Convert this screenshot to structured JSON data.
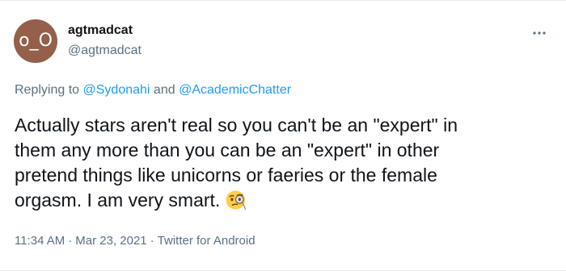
{
  "user": {
    "avatar_text": "o_O",
    "avatar_color": "#955f49",
    "display_name": "agtmadcat",
    "handle": "@agtmadcat"
  },
  "more_icon": "more-horizontal-icon",
  "reply": {
    "prefix": "Replying to",
    "mention1": "@Sydonahi",
    "conj": "and",
    "mention2": "@AcademicChatter"
  },
  "tweet": {
    "lines": [
      "Actually stars aren't real so you can't be an \"expert\" in",
      "them any more than you can be an \"expert\" in other",
      "pretend things like unicorns or faeries or the female",
      "orgasm. I am very smart."
    ],
    "emoji": "face-with-monocle-icon"
  },
  "meta": {
    "time": "11:34 AM",
    "date": "Mar 23, 2021",
    "source": "Twitter for Android",
    "separator": "·"
  },
  "colors": {
    "text": "#0f1419",
    "secondary": "#5b7083",
    "link": "#1d9bf0"
  }
}
